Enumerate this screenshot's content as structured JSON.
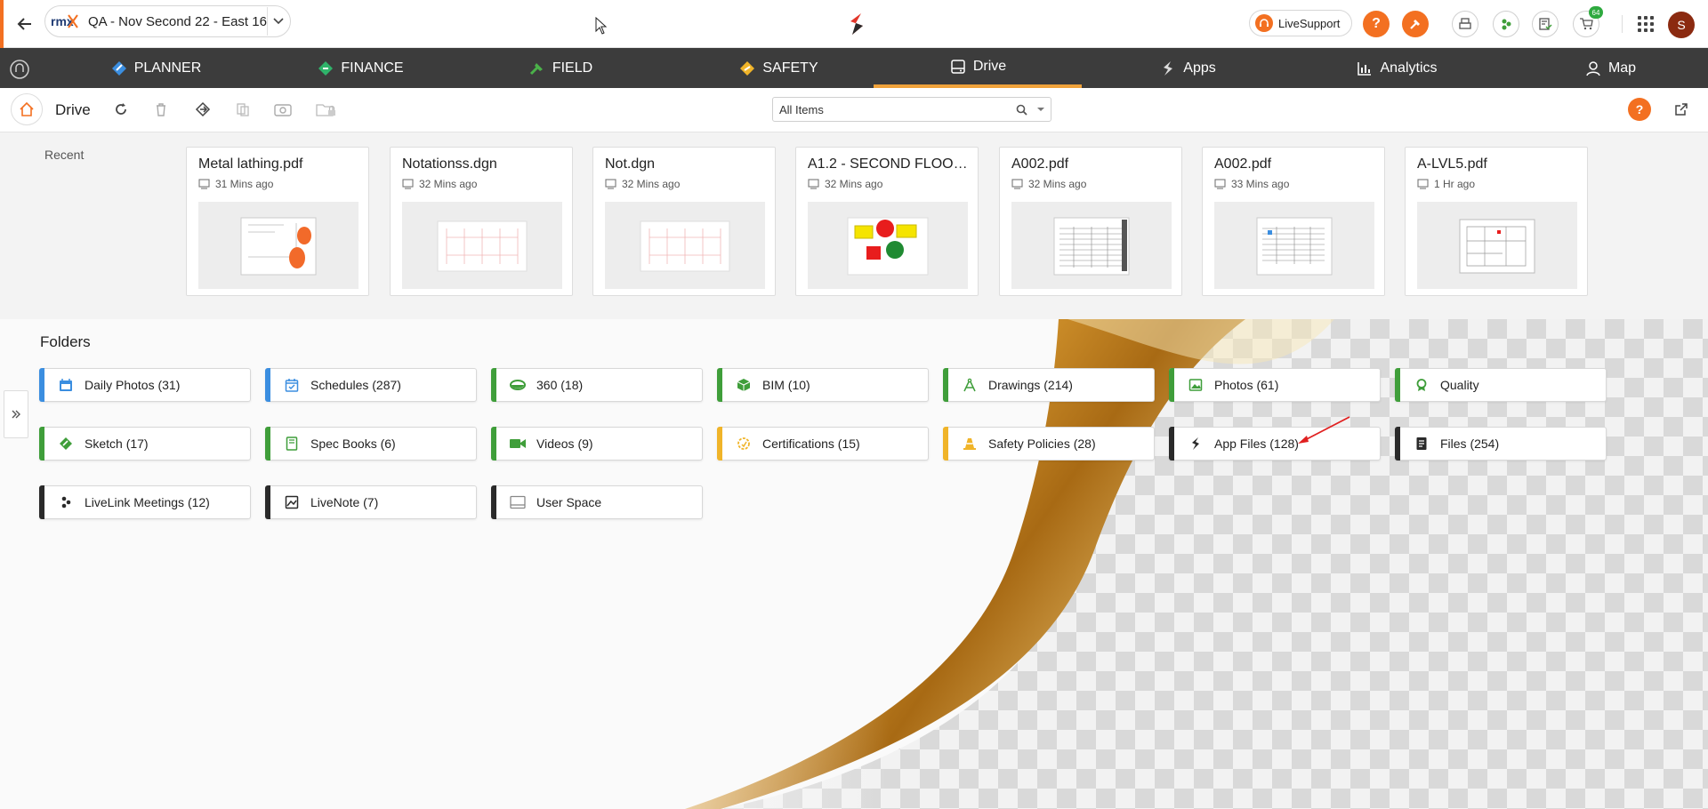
{
  "header": {
    "project_name": "QA - Nov Second 22 - East 16",
    "logo_text": "rmx",
    "live_support_label": "LiveSupport",
    "help_label": "?",
    "cart_count": "64",
    "avatar_initial": "S"
  },
  "modules": [
    {
      "label": "PLANNER",
      "icon": "planner-icon",
      "color": "#3b8ee0"
    },
    {
      "label": "FINANCE",
      "icon": "finance-icon",
      "color": "#2fb36a"
    },
    {
      "label": "FIELD",
      "icon": "field-icon",
      "color": "#4bb24a"
    },
    {
      "label": "SAFETY",
      "icon": "safety-icon",
      "color": "#f0b429"
    },
    {
      "label": "Drive",
      "icon": "drive-icon",
      "active": true
    },
    {
      "label": "Apps",
      "icon": "apps-icon"
    },
    {
      "label": "Analytics",
      "icon": "analytics-icon"
    },
    {
      "label": "Map",
      "icon": "map-icon"
    }
  ],
  "toolbar": {
    "title": "Drive",
    "search_value": "All Items"
  },
  "recent": {
    "label": "Recent",
    "files": [
      {
        "name": "Metal lathing.pdf",
        "time": "31 Mins ago"
      },
      {
        "name": "Notationss.dgn",
        "time": "32 Mins ago"
      },
      {
        "name": "Not.dgn",
        "time": "32 Mins ago"
      },
      {
        "name": "A1.2 - SECOND FLOOR ...",
        "time": "32 Mins ago"
      },
      {
        "name": "A002.pdf",
        "time": "32 Mins ago"
      },
      {
        "name": "A002.pdf",
        "time": "33 Mins ago"
      },
      {
        "name": "A-LVL5.pdf",
        "time": "1 Hr ago"
      }
    ]
  },
  "folders": {
    "label": "Folders",
    "items": [
      {
        "label": "Daily Photos (31)",
        "icon": "daily-photos-icon",
        "color": "#3b8ee0"
      },
      {
        "label": "Schedules (287)",
        "icon": "calendar-icon",
        "color": "#3b8ee0"
      },
      {
        "label": "360 (18)",
        "icon": "360-icon",
        "color": "#3f9e3a"
      },
      {
        "label": "BIM (10)",
        "icon": "bim-cube-icon",
        "color": "#3f9e3a"
      },
      {
        "label": "Drawings (214)",
        "icon": "compass-icon",
        "color": "#3f9e3a"
      },
      {
        "label": "Photos (61)",
        "icon": "image-icon",
        "color": "#3f9e3a"
      },
      {
        "label": "Quality",
        "icon": "badge-icon",
        "color": "#3f9e3a"
      },
      {
        "label": "Sketch (17)",
        "icon": "sketch-icon",
        "color": "#3f9e3a"
      },
      {
        "label": "Spec Books (6)",
        "icon": "book-icon",
        "color": "#3f9e3a"
      },
      {
        "label": "Videos (9)",
        "icon": "video-camera-icon",
        "color": "#3f9e3a"
      },
      {
        "label": "Certifications (15)",
        "icon": "certificate-icon",
        "color": "#f0b429"
      },
      {
        "label": "Safety Policies (28)",
        "icon": "cone-icon",
        "color": "#f0b429"
      },
      {
        "label": "App Files (128)",
        "icon": "app-files-icon",
        "color": "#2a2a2a"
      },
      {
        "label": "Files (254)",
        "icon": "document-icon",
        "color": "#2a2a2a"
      },
      {
        "label": "LiveLink Meetings (12)",
        "icon": "people-icon",
        "color": "#2a2a2a"
      },
      {
        "label": "LiveNote (7)",
        "icon": "note-image-icon",
        "color": "#2a2a2a"
      },
      {
        "label": "User Space",
        "icon": "user-space-icon",
        "color": "#2a2a2a"
      }
    ]
  },
  "colors": {
    "accent_orange": "#f37021",
    "nav_bg": "#3c3c3c",
    "nav_active_underline": "#f0a23a",
    "gold_curl": "#e8a93a"
  }
}
